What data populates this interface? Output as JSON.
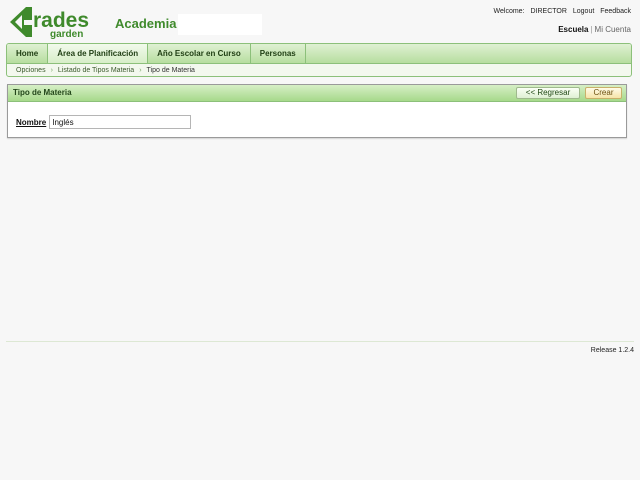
{
  "header": {
    "logo_word_top": "rades",
    "logo_word_bottom": "garden",
    "app_title": "Academia",
    "welcome_prefix": "Welcome:",
    "user_name": "DIRECTOR",
    "logout_label": "Logout",
    "feedback_label": "Feedback",
    "context_active": "Escuela",
    "context_separator": "|",
    "context_other": "Mi Cuenta"
  },
  "nav": {
    "tabs": [
      {
        "label": "Home"
      },
      {
        "label": "Área de Planificación"
      },
      {
        "label": "Año Escolar en Curso"
      },
      {
        "label": "Personas"
      }
    ],
    "breadcrumb": [
      {
        "label": "Opciones"
      },
      {
        "label": "Listado de Tipos Materia"
      },
      {
        "label": "Tipo de Materia"
      }
    ]
  },
  "panel": {
    "title": "Tipo de Materia",
    "back_label": "<< Regresar",
    "create_label": "Crear",
    "field_label": "Nombre",
    "field_value": "Inglés"
  },
  "footer": {
    "release": "Release 1.2.4"
  },
  "colors": {
    "brand_green": "#3f8a2c",
    "tab_border": "#8cc07a",
    "create_button": "#f6e4a8"
  }
}
